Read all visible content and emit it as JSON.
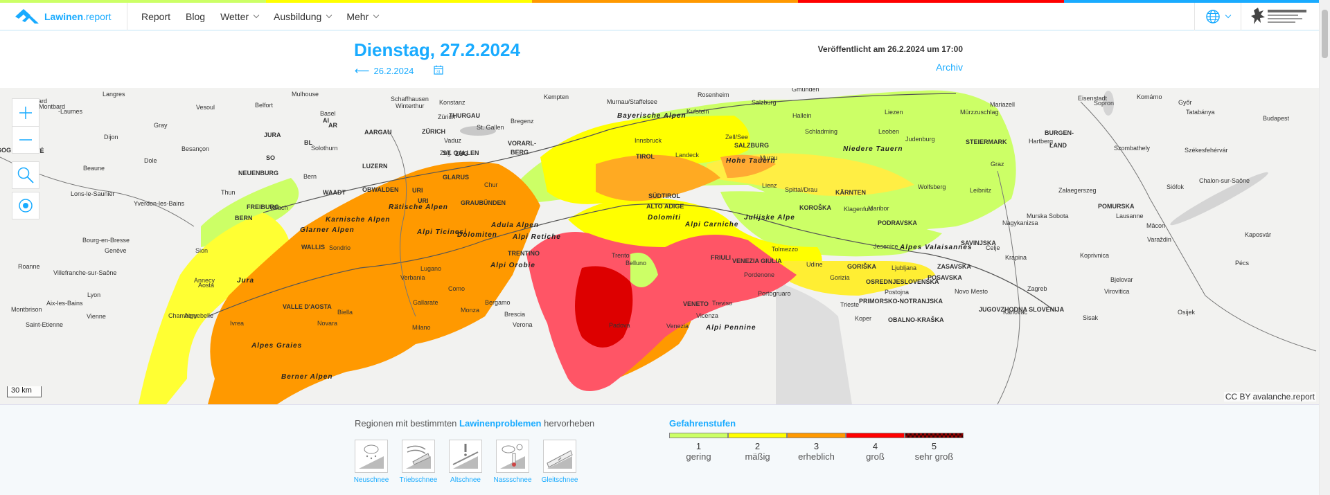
{
  "brand": {
    "name_main": "Lawinen",
    "name_suffix": ".report"
  },
  "stripe_colors": [
    "#ccff66",
    "#ffff00",
    "#ff9900",
    "#ff0000",
    "#19abff"
  ],
  "nav": {
    "items": [
      {
        "label": "Report",
        "dropdown": false
      },
      {
        "label": "Blog",
        "dropdown": false
      },
      {
        "label": "Wetter",
        "dropdown": true
      },
      {
        "label": "Ausbildung",
        "dropdown": true
      },
      {
        "label": "Mehr",
        "dropdown": true
      }
    ],
    "language_icon": "globe-icon"
  },
  "bulletin": {
    "date_title": "Dienstag, 27.2.2024",
    "previous_date": "26.2.2024",
    "published": "Veröffentlicht am 26.2.2024 um 17:00",
    "archive_label": "Archiv"
  },
  "map": {
    "scale_label": "30 km",
    "attribution": "CC BY avalanche.report",
    "controls": [
      "zoom-in-icon",
      "zoom-out-icon",
      "search-icon",
      "locate-icon"
    ],
    "labels": [
      {
        "text": "Langres",
        "cls": ""
      },
      {
        "text": "Montbard",
        "cls": ""
      },
      {
        "text": "Vesoul",
        "cls": ""
      },
      {
        "text": "Belfort",
        "cls": ""
      },
      {
        "text": "Mulhouse",
        "cls": ""
      },
      {
        "text": "Basel",
        "cls": ""
      },
      {
        "text": "Schaffhausen",
        "cls": ""
      },
      {
        "text": "Konstanz",
        "cls": ""
      },
      {
        "text": "Kempten",
        "cls": ""
      },
      {
        "text": "Murnau/Staffelsee",
        "cls": ""
      },
      {
        "text": "Rosenheim",
        "cls": ""
      },
      {
        "text": "Salzburg",
        "cls": ""
      },
      {
        "text": "Gmunden",
        "cls": ""
      },
      {
        "text": "Eisenstadt",
        "cls": ""
      },
      {
        "text": "Mariazell",
        "cls": ""
      },
      {
        "text": "Komárno",
        "cls": ""
      },
      {
        "text": "Győr",
        "cls": ""
      },
      {
        "text": "Tatabánya",
        "cls": ""
      },
      {
        "text": "Budapest",
        "cls": ""
      },
      {
        "text": "Dijon",
        "cls": ""
      },
      {
        "text": "Gray",
        "cls": ""
      },
      {
        "text": "Besançon",
        "cls": ""
      },
      {
        "text": "JURA",
        "cls": "b"
      },
      {
        "text": "AARGAU",
        "cls": "b"
      },
      {
        "text": "ZÜRICH",
        "cls": "b"
      },
      {
        "text": "THURGAU",
        "cls": "b"
      },
      {
        "text": "St. Gallen",
        "cls": ""
      },
      {
        "text": "Bregenz",
        "cls": ""
      },
      {
        "text": "Kufstein",
        "cls": ""
      },
      {
        "text": "Hallein",
        "cls": ""
      },
      {
        "text": "Liezen",
        "cls": ""
      },
      {
        "text": "Mürzzuschlag",
        "cls": ""
      },
      {
        "text": "Sopron",
        "cls": ""
      },
      {
        "text": "Bayerische Alpen",
        "cls": "i"
      },
      {
        "text": "Innsbruck",
        "cls": ""
      },
      {
        "text": "Zell/See",
        "cls": ""
      },
      {
        "text": "Schladming",
        "cls": ""
      },
      {
        "text": "Leoben",
        "cls": ""
      },
      {
        "text": "BURGEN-",
        "cls": "b"
      },
      {
        "text": "LAND",
        "cls": "b"
      },
      {
        "text": "Hartberg",
        "cls": ""
      },
      {
        "text": "Szombathely",
        "cls": ""
      },
      {
        "text": "Székesfehérvár",
        "cls": ""
      },
      {
        "text": "COMTÉ",
        "cls": "b"
      },
      {
        "text": "Solothurn",
        "cls": ""
      },
      {
        "text": "ST. GALLEN",
        "cls": "b"
      },
      {
        "text": "VORARL-",
        "cls": "b"
      },
      {
        "text": "BERG",
        "cls": "b"
      },
      {
        "text": "Landeck",
        "cls": ""
      },
      {
        "text": "TIROL",
        "cls": "b"
      },
      {
        "text": "SALZBURG",
        "cls": "b"
      },
      {
        "text": "Niedere Tauern",
        "cls": "i"
      },
      {
        "text": "Judenburg",
        "cls": ""
      },
      {
        "text": "STEIERMARK",
        "cls": "b"
      },
      {
        "text": "Beaune",
        "cls": ""
      },
      {
        "text": "Dole",
        "cls": ""
      },
      {
        "text": "LUZERN",
        "cls": "b"
      },
      {
        "text": "GLARUS",
        "cls": "b"
      },
      {
        "text": "Chur",
        "cls": ""
      },
      {
        "text": "Hohe Tauern",
        "cls": "i"
      },
      {
        "text": "Murau",
        "cls": ""
      },
      {
        "text": "Graz",
        "cls": ""
      },
      {
        "text": "NEUENBURG",
        "cls": "b"
      },
      {
        "text": "Bern",
        "cls": ""
      },
      {
        "text": "OBWALDEN",
        "cls": "b"
      },
      {
        "text": "URI",
        "cls": "b"
      },
      {
        "text": "GRAUBÜNDEN",
        "cls": "b"
      },
      {
        "text": "SÜDTIROL",
        "cls": "b"
      },
      {
        "text": "ALTO ADIGE",
        "cls": "b"
      },
      {
        "text": "Lienz",
        "cls": ""
      },
      {
        "text": "Spittal/Drau",
        "cls": ""
      },
      {
        "text": "KÄRNTEN",
        "cls": "b"
      },
      {
        "text": "Wolfsberg",
        "cls": ""
      },
      {
        "text": "Leibnitz",
        "cls": ""
      },
      {
        "text": "Zalaegerszeg",
        "cls": ""
      },
      {
        "text": "Siófok",
        "cls": ""
      },
      {
        "text": "Chalon-sur-Saône",
        "cls": ""
      },
      {
        "text": "Lons-le-Saunier",
        "cls": ""
      },
      {
        "text": "Yverdon-les-Bains",
        "cls": ""
      },
      {
        "text": "Thun",
        "cls": ""
      },
      {
        "text": "WAADT",
        "cls": "b"
      },
      {
        "text": "FREIBURG",
        "cls": "b"
      },
      {
        "text": "Villach",
        "cls": ""
      },
      {
        "text": "Klagenfurt",
        "cls": ""
      },
      {
        "text": "Maribor",
        "cls": ""
      },
      {
        "text": "Murska Sobota",
        "cls": ""
      },
      {
        "text": "POMURSKA",
        "cls": "b"
      },
      {
        "text": "Lausanne",
        "cls": ""
      },
      {
        "text": "BERN",
        "cls": "b"
      },
      {
        "text": "Karnische Alpen",
        "cls": "i"
      },
      {
        "text": "KOROŠKA",
        "cls": "b"
      },
      {
        "text": "PODRAVSKA",
        "cls": "b"
      },
      {
        "text": "Nagykanizsa",
        "cls": ""
      },
      {
        "text": "Mâcon",
        "cls": ""
      },
      {
        "text": "Bourg-en-Bresse",
        "cls": ""
      },
      {
        "text": "Genève",
        "cls": ""
      },
      {
        "text": "Sion",
        "cls": ""
      },
      {
        "text": "WALLIS",
        "cls": "b"
      },
      {
        "text": "Sondrio",
        "cls": ""
      },
      {
        "text": "TRENTINO",
        "cls": "b"
      },
      {
        "text": "Trento",
        "cls": ""
      },
      {
        "text": "Belluno",
        "cls": ""
      },
      {
        "text": "FRIULI",
        "cls": "b"
      },
      {
        "text": "VENEZIA GIULIA",
        "cls": "b"
      },
      {
        "text": "Tolmezzo",
        "cls": ""
      },
      {
        "text": "Jesenice",
        "cls": ""
      },
      {
        "text": "SAVINJSKA",
        "cls": "b"
      },
      {
        "text": "Celje",
        "cls": ""
      },
      {
        "text": "Varaždin",
        "cls": ""
      },
      {
        "text": "Kaposvár",
        "cls": ""
      },
      {
        "text": "Roanne",
        "cls": ""
      },
      {
        "text": "Villefranche-sur-Saône",
        "cls": ""
      },
      {
        "text": "Annecy",
        "cls": ""
      },
      {
        "text": "Lugano",
        "cls": ""
      },
      {
        "text": "Alpi Orobie",
        "cls": "i"
      },
      {
        "text": "Udine",
        "cls": ""
      },
      {
        "text": "GORIŠKA",
        "cls": "b"
      },
      {
        "text": "Ljubljana",
        "cls": ""
      },
      {
        "text": "ZASAVSKA",
        "cls": "b"
      },
      {
        "text": "Krapina",
        "cls": ""
      },
      {
        "text": "Koprivnica",
        "cls": ""
      },
      {
        "text": "Pécs",
        "cls": ""
      },
      {
        "text": "Verbania",
        "cls": ""
      },
      {
        "text": "Aosta",
        "cls": ""
      },
      {
        "text": "Pordenone",
        "cls": ""
      },
      {
        "text": "Gorizia",
        "cls": ""
      },
      {
        "text": "OSREDNJESLOVENSKA",
        "cls": "b"
      },
      {
        "text": "POSAVSKA",
        "cls": "b"
      },
      {
        "text": "Bjelovar",
        "cls": ""
      },
      {
        "text": "Lyon",
        "cls": ""
      },
      {
        "text": "Como",
        "cls": ""
      },
      {
        "text": "Portogruaro",
        "cls": ""
      },
      {
        "text": "Postojna",
        "cls": ""
      },
      {
        "text": "Novo Mesto",
        "cls": ""
      },
      {
        "text": "Zagreb",
        "cls": ""
      },
      {
        "text": "Virovitica",
        "cls": ""
      },
      {
        "text": "Aix-les-Bains",
        "cls": ""
      },
      {
        "text": "VALLE D'AOSTA",
        "cls": "b"
      },
      {
        "text": "Gallarate",
        "cls": ""
      },
      {
        "text": "Bergamo",
        "cls": ""
      },
      {
        "text": "VENETO",
        "cls": "b"
      },
      {
        "text": "Treviso",
        "cls": ""
      },
      {
        "text": "Trieste",
        "cls": ""
      },
      {
        "text": "PRIMORSKO-NOTRANJSKA",
        "cls": "b"
      },
      {
        "text": "JUGOVZHODNA SLOVENIJA",
        "cls": "b"
      },
      {
        "text": "Montbrison",
        "cls": ""
      },
      {
        "text": "Chambery",
        "cls": ""
      },
      {
        "text": "Aiguebelle",
        "cls": ""
      },
      {
        "text": "Biella",
        "cls": ""
      },
      {
        "text": "Monza",
        "cls": ""
      },
      {
        "text": "Brescia",
        "cls": ""
      },
      {
        "text": "Vicenza",
        "cls": ""
      },
      {
        "text": "Koper",
        "cls": ""
      },
      {
        "text": "OBALNO-KRAŠKA",
        "cls": "b"
      },
      {
        "text": "Karlovac",
        "cls": ""
      },
      {
        "text": "Sisak",
        "cls": ""
      },
      {
        "text": "Osijek",
        "cls": ""
      },
      {
        "text": "Saint-Etienne",
        "cls": ""
      },
      {
        "text": "Vienne",
        "cls": ""
      },
      {
        "text": "Ivrea",
        "cls": ""
      },
      {
        "text": "Novara",
        "cls": ""
      },
      {
        "text": "Milano",
        "cls": ""
      },
      {
        "text": "Verona",
        "cls": ""
      },
      {
        "text": "Padova",
        "cls": ""
      },
      {
        "text": "Venezia",
        "cls": ""
      },
      {
        "text": "Alpi Pennine",
        "cls": "i"
      },
      {
        "text": "Berner Alpen",
        "cls": "i"
      },
      {
        "text": "Glarner Alpen",
        "cls": "i"
      },
      {
        "text": "Rätische Alpen",
        "cls": "i"
      },
      {
        "text": "Adula Alpen",
        "cls": "i"
      },
      {
        "text": "Alpi Ticinesi",
        "cls": "i"
      },
      {
        "text": "Dolomiten",
        "cls": "i"
      },
      {
        "text": "Dolomiti",
        "cls": "i"
      },
      {
        "text": "Alpi Carniche",
        "cls": "i"
      },
      {
        "text": "Julijske Alpe",
        "cls": "i"
      },
      {
        "text": "Alpes Valaisannes",
        "cls": "i"
      },
      {
        "text": "Jura",
        "cls": "i"
      },
      {
        "text": "SO",
        "cls": "b"
      },
      {
        "text": "BL",
        "cls": "b"
      },
      {
        "text": "AR",
        "cls": "b"
      },
      {
        "text": "AI",
        "cls": "b"
      },
      {
        "text": "Zürich",
        "cls": ""
      },
      {
        "text": "Winterthur",
        "cls": ""
      },
      {
        "text": "Zug",
        "cls": ""
      },
      {
        "text": "ZUG",
        "cls": "b"
      },
      {
        "text": "Vaduz",
        "cls": ""
      },
      {
        "text": "URI",
        "cls": "b"
      },
      {
        "text": "Montbéliard",
        "cls": ""
      },
      {
        "text": "-Laumes",
        "cls": ""
      },
      {
        "text": "GOG",
        "cls": "b"
      },
      {
        "text": "Alpes Graies",
        "cls": "i"
      },
      {
        "text": "Alpi Retiche",
        "cls": "i"
      }
    ]
  },
  "legend": {
    "problems_prefix": "Regionen mit bestimmten",
    "problems_keyword": "Lawinenproblemen",
    "problems_suffix": "hervorheben",
    "problems": [
      {
        "label": "Neuschnee",
        "icon": "new-snow-icon"
      },
      {
        "label": "Triebschnee",
        "icon": "wind-slab-icon"
      },
      {
        "label": "Altschnee",
        "icon": "persistent-weak-layers-icon"
      },
      {
        "label": "Nassschnee",
        "icon": "wet-snow-icon"
      },
      {
        "label": "Gleitschnee",
        "icon": "gliding-snow-icon"
      }
    ],
    "danger_title": "Gefahrenstufen",
    "danger_levels": [
      {
        "num": "1",
        "name": "gering",
        "color": "#ccff66"
      },
      {
        "num": "2",
        "name": "mäßig",
        "color": "#ffff00"
      },
      {
        "num": "3",
        "name": "erheblich",
        "color": "#ff9900"
      },
      {
        "num": "4",
        "name": "groß",
        "color": "#ff0000"
      },
      {
        "num": "5",
        "name": "sehr groß",
        "color": "#660000"
      }
    ]
  }
}
